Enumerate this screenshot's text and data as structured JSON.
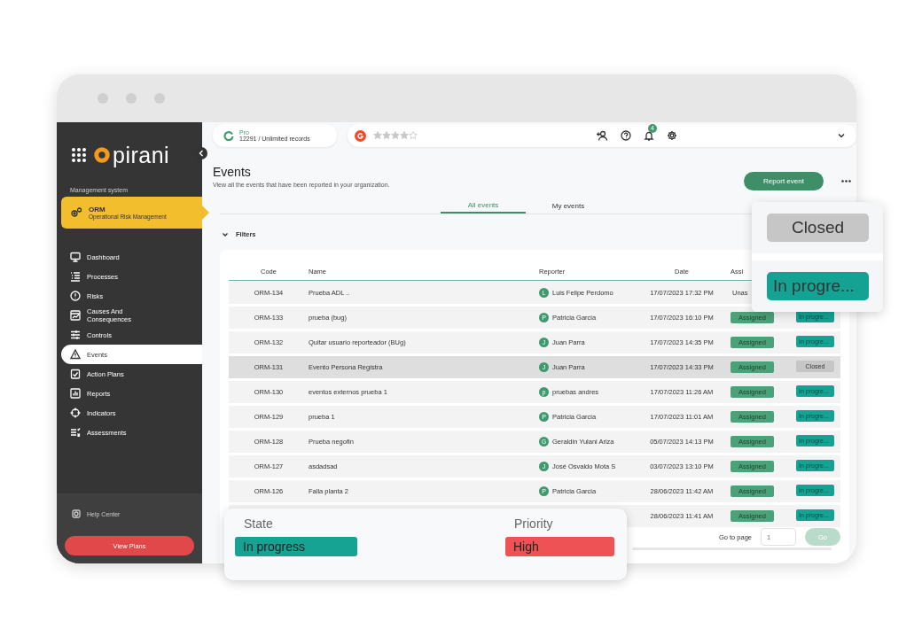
{
  "sidebar": {
    "logo": "pirani",
    "section_label": "Management system",
    "module": {
      "title": "ORM",
      "subtitle": "Operational Risk Management"
    },
    "items": [
      {
        "label": "Dashboard",
        "selected": false
      },
      {
        "label": "Processes",
        "selected": false
      },
      {
        "label": "Risks",
        "selected": false
      },
      {
        "label": "Causes And Consequences",
        "selected": false
      },
      {
        "label": "Controls",
        "selected": false
      },
      {
        "label": "Events",
        "selected": true
      },
      {
        "label": "Action Plans",
        "selected": false
      },
      {
        "label": "Reports",
        "selected": false
      },
      {
        "label": "Indicators",
        "selected": false
      },
      {
        "label": "Assessments",
        "selected": false
      }
    ],
    "help": "Help Center",
    "cta": "View Plans"
  },
  "topbar": {
    "plan": "Pro",
    "records": "12291 / Unlimited records",
    "notifications": "4"
  },
  "page": {
    "title": "Events",
    "subtitle": "View all the events that have been reported in your organization.",
    "primary_action": "Report event"
  },
  "tabs": [
    {
      "label": "All events",
      "selected": true
    },
    {
      "label": "My events",
      "selected": false
    }
  ],
  "filters": {
    "label": "Filters"
  },
  "table": {
    "columns": [
      "Code",
      "Name",
      "Reporter",
      "Date",
      "Assi"
    ],
    "rows": [
      {
        "code": "ORM-134",
        "name": "Prueba ADL ..",
        "initial": "L",
        "reporter": "Luis Felipe Perdomo",
        "date": "17/07/2023 17:32 PM",
        "assignment": "Unas",
        "assigned": false,
        "selected": false
      },
      {
        "code": "ORM-133",
        "name": "prueba (bug)",
        "initial": "P",
        "reporter": "Patricia Garcia",
        "date": "17/07/2023 16:10 PM",
        "assignment": "Assigned",
        "assigned": true,
        "state": "In progre...",
        "kind": "in_progress",
        "selected": false
      },
      {
        "code": "ORM-132",
        "name": "Quitar usuario reporteador (BUg)",
        "initial": "J",
        "reporter": "Juan Parra",
        "date": "17/07/2023 14:35 PM",
        "assignment": "Assigned",
        "assigned": true,
        "state": "In progre...",
        "kind": "in_progress",
        "selected": false
      },
      {
        "code": "ORM-131",
        "name": "Evento Persona Registra",
        "initial": "J",
        "reporter": "Juan Parra",
        "date": "17/07/2023 14:33 PM",
        "assignment": "Assigned",
        "assigned": true,
        "state": "Closed",
        "kind": "closed",
        "selected": true
      },
      {
        "code": "ORM-130",
        "name": "eventos externos prueba 1",
        "initial": "p",
        "reporter": "pruebas andres",
        "date": "17/07/2023 11:26 AM",
        "assignment": "Assigned",
        "assigned": true,
        "state": "In progre...",
        "kind": "in_progress",
        "selected": false
      },
      {
        "code": "ORM-129",
        "name": "prueba 1",
        "initial": "P",
        "reporter": "Patricia Garcia",
        "date": "17/07/2023 11:01 AM",
        "assignment": "Assigned",
        "assigned": true,
        "state": "In progre...",
        "kind": "in_progress",
        "selected": false
      },
      {
        "code": "ORM-128",
        "name": "Prueba negofin",
        "initial": "G",
        "reporter": "Geraldin Yulani Ariza",
        "date": "05/07/2023 14:13 PM",
        "assignment": "Assigned",
        "assigned": true,
        "state": "In progre...",
        "kind": "in_progress",
        "selected": false
      },
      {
        "code": "ORM-127",
        "name": "asdadsad",
        "initial": "J",
        "reporter": "José Osvaldo Mota S",
        "date": "03/07/2023 13:10 PM",
        "assignment": "Assigned",
        "assigned": true,
        "state": "In progre...",
        "kind": "in_progress",
        "selected": false
      },
      {
        "code": "ORM-126",
        "name": "Falla planta 2",
        "initial": "P",
        "reporter": "Patricia Garcia",
        "date": "28/06/2023 11:42 AM",
        "assignment": "Assigned",
        "assigned": true,
        "state": "In progre...",
        "kind": "in_progress",
        "selected": false
      },
      {
        "date": "28/06/2023 11:41 AM",
        "assignment": "Assigned",
        "assigned": true,
        "state": "In progre...",
        "kind": "in_progress",
        "selected": false
      }
    ]
  },
  "pagination": {
    "label": "Go to page",
    "placeholder": "1",
    "button": "Go"
  },
  "state_popup": {
    "options": [
      {
        "label": "Closed",
        "kind": "closed"
      },
      {
        "label": "In progre...",
        "kind": "in_progress"
      }
    ]
  },
  "detail_card": {
    "fields": [
      {
        "label": "State",
        "value": "In progress",
        "kind": "state"
      },
      {
        "label": "Priority",
        "value": "High",
        "kind": "priority"
      }
    ]
  }
}
